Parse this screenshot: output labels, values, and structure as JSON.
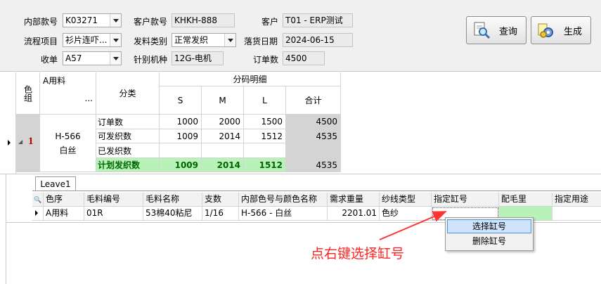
{
  "form": {
    "internal_no_label": "内部款号",
    "internal_no_value": "K03271",
    "customer_no_label": "客户款号",
    "customer_no_value": "KHKH-888",
    "customer_label": "客户",
    "customer_value": "T01 - ERP测试",
    "flow_label": "流程项目",
    "flow_value": "衫片连吓...",
    "material_type_label": "发料类别",
    "material_type_value": "正常发织",
    "order_date_label": "落货日期",
    "order_date_value": "2024-06-15",
    "receipt_label": "收单",
    "receipt_value": "A57",
    "needle_label": "针别机种",
    "needle_value": "12G-电机",
    "order_qty_label": "订单数",
    "order_qty_value": "4500"
  },
  "buttons": {
    "query": "查询",
    "generate": "生成"
  },
  "grid1": {
    "color_group_header": "色组",
    "material_header": "A用料",
    "ellipsis": "...",
    "category_header": "分类",
    "size_group_header": "分码明细",
    "sizes": [
      "S",
      "M",
      "L"
    ],
    "total_header": "合计",
    "row_index": "1",
    "style_code": "H-566",
    "style_color": "白丝",
    "rows": [
      {
        "label": "订单数",
        "s": "1000",
        "m": "2000",
        "l": "1500",
        "total": "4500"
      },
      {
        "label": "可发织数",
        "s": "1009",
        "m": "2014",
        "l": "1512",
        "total": "4535"
      },
      {
        "label": "已发织数",
        "s": "",
        "m": "",
        "l": "",
        "total": ""
      },
      {
        "label": "计划发织数",
        "s": "1009",
        "m": "2014",
        "l": "1512",
        "total": "4535"
      }
    ]
  },
  "tab": {
    "label": "Leave1"
  },
  "grid2": {
    "headers": [
      "色序",
      "毛料编号",
      "毛料名称",
      "支数",
      "内部色号与颜色名称",
      "需求重量",
      "纱线类型",
      "指定缸号",
      "配毛里",
      "指定用途"
    ],
    "row": [
      "A用料",
      "01R",
      "53棉40粘尼",
      "1/16",
      "H-566 - 白丝",
      "2201.01",
      "色纱",
      "",
      "",
      ""
    ]
  },
  "context_menu": {
    "items": [
      "选择缸号",
      "删除缸号"
    ]
  },
  "annotation": "点右键选择缸号",
  "colors": {
    "accent_green": "#b8f2b8",
    "annotation_red": "#ff2222",
    "menu_highlight": "#cfe4fb"
  }
}
